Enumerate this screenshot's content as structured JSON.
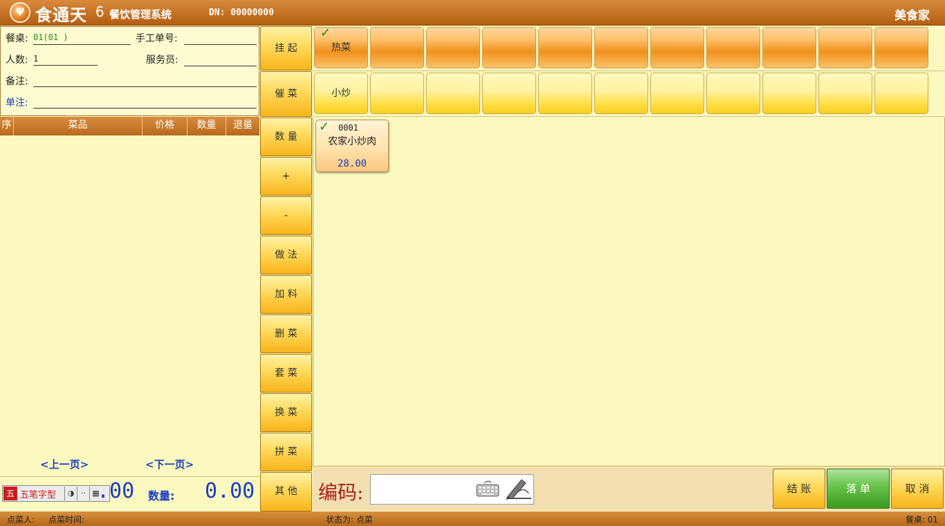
{
  "titlebar": {
    "logo_glyph": "Ψ",
    "app_name": "食通天",
    "version": "6",
    "subtitle": "餐饮管理系统",
    "dn": "DN: 00000000",
    "brand": "美食家"
  },
  "info": {
    "table_label": "餐桌:",
    "table_value": "01(01  )",
    "manual_no_label": "手工单号:",
    "guests_label": "人数:",
    "guests_value": "1",
    "waiter_label": "服务员:",
    "remark_label": "备注:",
    "order_note_label": "单注:"
  },
  "order_table": {
    "columns": [
      "序",
      "菜品",
      "价格",
      "数量",
      "退量"
    ]
  },
  "pager": {
    "prev": "<上一页>",
    "next": "<下一页>"
  },
  "ime": {
    "icon": "五",
    "name": "五笔字型",
    "btn_moon": "◑",
    "btn_dots": "··",
    "btn_kbd": "▦"
  },
  "totals": {
    "amount_value": ".00",
    "qty_label": "数量:",
    "qty_value": "0.00"
  },
  "actions": [
    "挂 起",
    "催 菜",
    "数 量",
    "+",
    "-",
    "做 法",
    "加 料",
    "删 菜",
    "套 菜",
    "换 菜",
    "拼 菜",
    "其 他"
  ],
  "categories": {
    "row1_first": "热菜",
    "row2_first": "小炒"
  },
  "dish": {
    "code": "0001",
    "name": "农家小炒肉",
    "price": "28.00"
  },
  "codebar": {
    "label": "编码:",
    "input_value": "",
    "checkout": "结 账",
    "submit": "落 单",
    "cancel": "取 消"
  },
  "status": {
    "orderer": "点菜人:",
    "order_time": "点菜时间:",
    "state": "状态为: 点菜",
    "table": "餐桌: 01"
  },
  "colors": {
    "titlebar": "#c4742a",
    "panel_bg": "#fbf8c0",
    "accent_blue": "#1a3fbf",
    "submit_green": "#4aa82a"
  }
}
